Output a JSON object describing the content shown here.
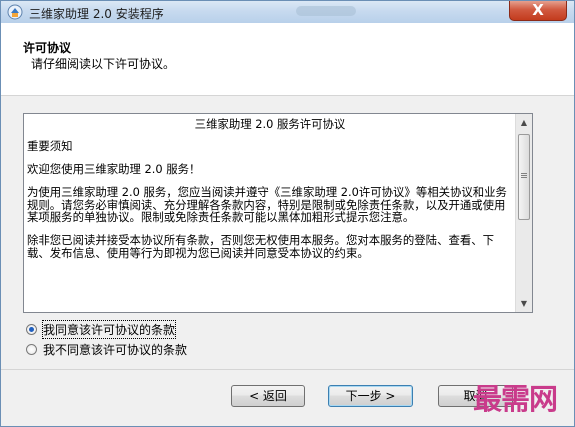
{
  "window": {
    "title": "三维家助理 2.0 安装程序",
    "close_label": "X"
  },
  "header": {
    "title": "许可协议",
    "subtitle": "请仔细阅读以下许可协议。"
  },
  "agreement": {
    "heading": "三维家助理 2.0 服务许可协议",
    "notice": "重要须知",
    "welcome": "欢迎您使用三维家助理 2.0 服务！",
    "para1": "为使用三维家助理 2.0 服务，您应当阅读并遵守《三维家助理 2.0许可协议》等相关协议和业务规则。请您务必审慎阅读、充分理解各条款内容，特别是限制或免除责任条款，以及开通或使用某项服务的单独协议。限制或免除责任条款可能以黑体加粗形式提示您注意。",
    "para2": "除非您已阅读并接受本协议所有条款，否则您无权使用本服务。您对本服务的登陆、查看、下载、发布信息、使用等行为即视为您已阅读并同意受本协议的约束。"
  },
  "options": [
    {
      "label": "我同意该许可协议的条款",
      "checked": true
    },
    {
      "label": "我不同意该许可协议的条款",
      "checked": false
    }
  ],
  "buttons": {
    "back": "< 返回",
    "next": "下一步 >",
    "cancel": "取消"
  },
  "watermark": "最需网",
  "colors": {
    "accent": "#3c7fb1",
    "close": "#c33b1d",
    "watermark": "#c93b8b"
  },
  "icons": {
    "app": "installer-icon",
    "close": "close-icon",
    "scroll_up": "scroll-up-arrow-icon",
    "scroll_down": "scroll-down-arrow-icon"
  }
}
